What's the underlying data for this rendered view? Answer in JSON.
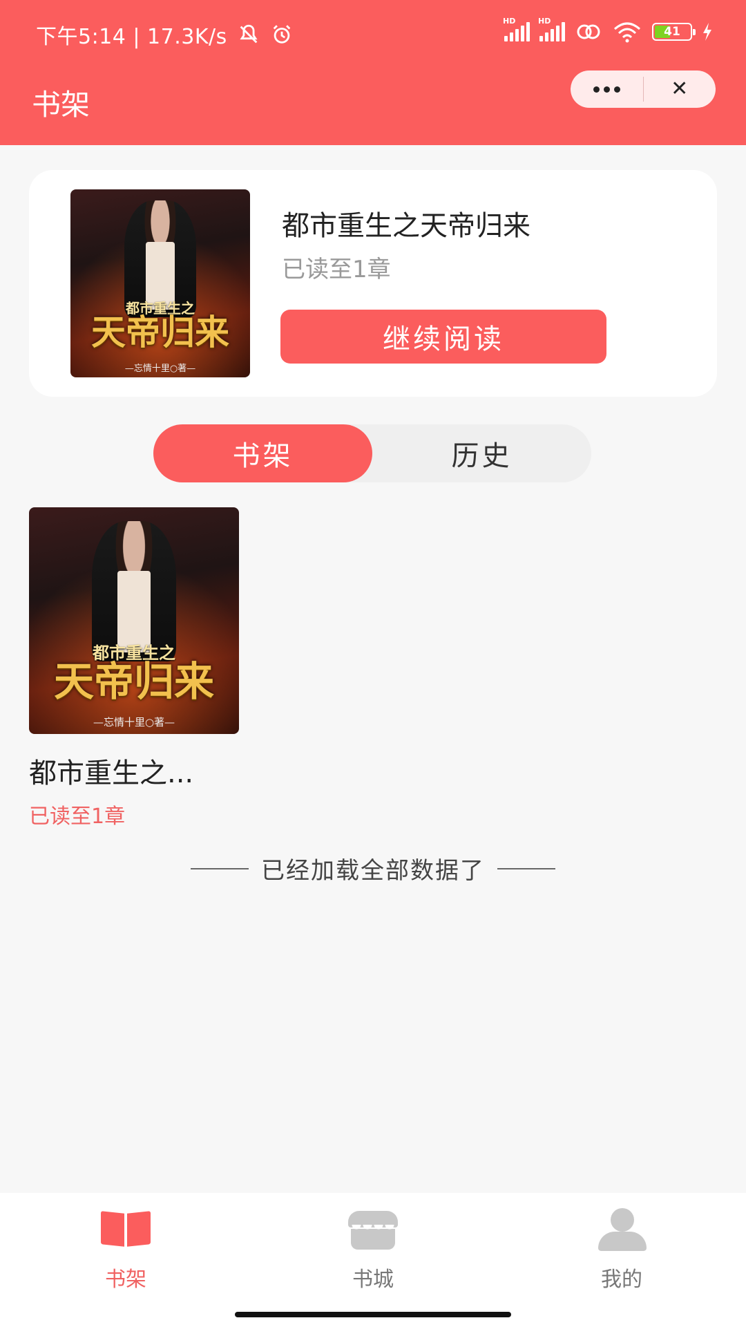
{
  "status_bar": {
    "time_speed": "下午5:14 | 17.3K/s",
    "battery": "41",
    "signal_label": "HD"
  },
  "nav": {
    "title": "书架"
  },
  "reading_card": {
    "book_title": "都市重生之天帝归来",
    "progress": "已读至1章",
    "continue_label": "继续阅读",
    "cover": {
      "subtitle": "都市重生之",
      "title": "天帝归来",
      "author": "—忘情十里○著—"
    }
  },
  "segment": {
    "tabs": [
      {
        "label": "书架",
        "active": true
      },
      {
        "label": "历史",
        "active": false
      }
    ]
  },
  "shelf": {
    "items": [
      {
        "title": "都市重生之...",
        "progress": "已读至1章",
        "cover": {
          "subtitle": "都市重生之",
          "title": "天帝归来",
          "author": "—忘情十里○著—"
        }
      }
    ],
    "end_text": "已经加载全部数据了"
  },
  "tabbar": {
    "tabs": [
      {
        "label": "书架",
        "icon": "bookshelf-icon",
        "active": true
      },
      {
        "label": "书城",
        "icon": "bookstore-icon",
        "active": false
      },
      {
        "label": "我的",
        "icon": "profile-icon",
        "active": false
      }
    ]
  },
  "colors": {
    "primary": "#fb5d5d",
    "page_bg": "#f7f7f7",
    "active_text": "#f06262",
    "inactive_icon": "#c8c8c8"
  }
}
